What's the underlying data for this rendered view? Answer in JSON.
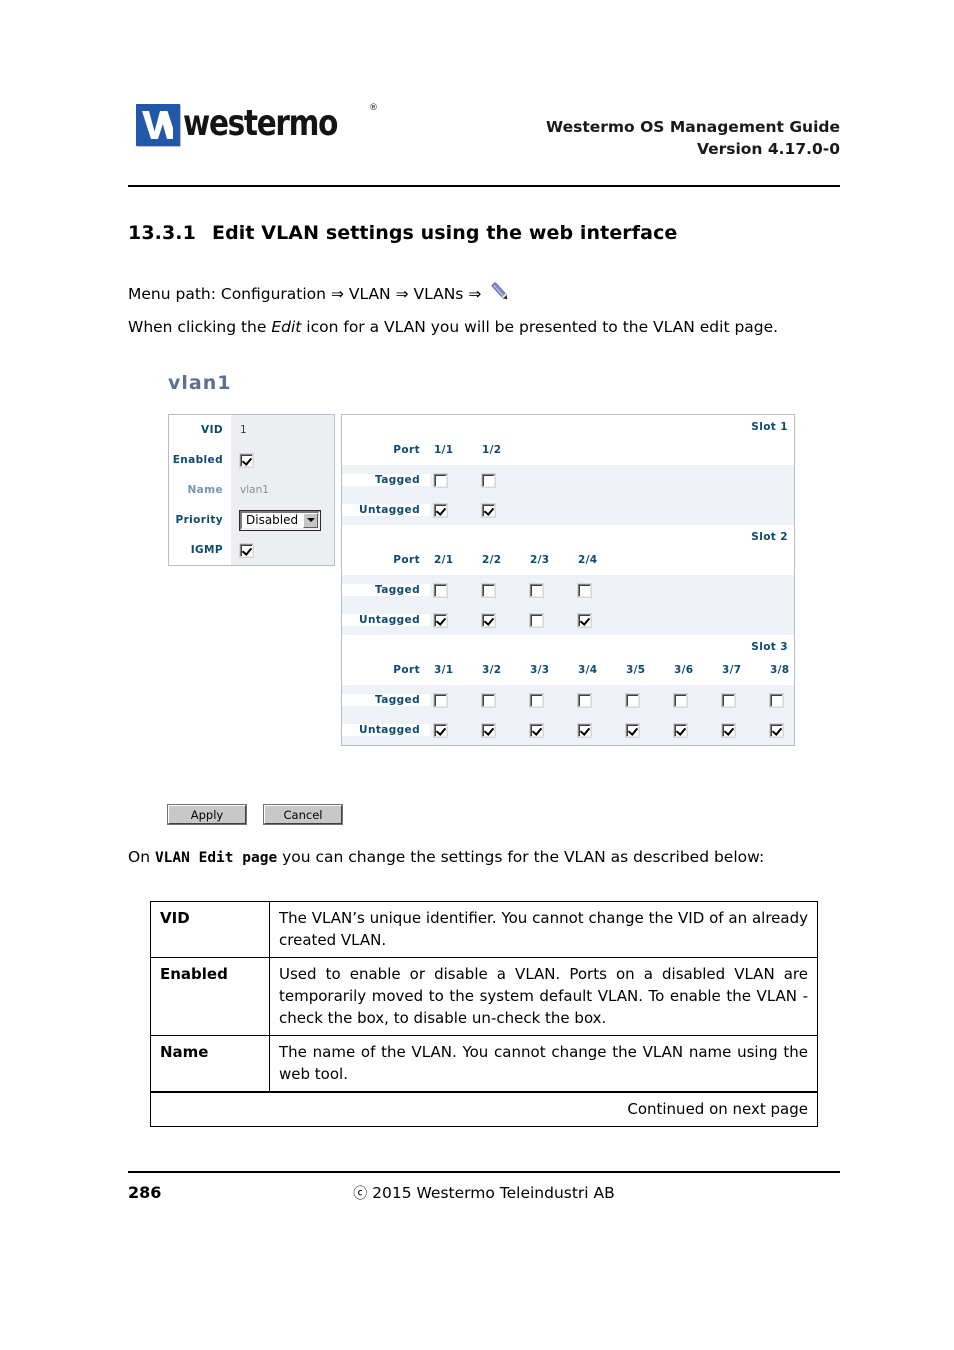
{
  "header": {
    "logo_word": "westermo",
    "logo_registered": "®",
    "title_line1": "Westermo OS Management Guide",
    "title_line2": "Version 4.17.0-0"
  },
  "section": {
    "number": "13.3.1",
    "heading": "Edit VLAN settings using the web interface",
    "menu_path_label": "Menu path: Configuration",
    "menu_path_sep1": "⇒ VLAN",
    "menu_path_sep2": "⇒ VLANs",
    "menu_path_sep3": "⇒",
    "menu_path_icon": "pencil-edit-icon",
    "intro_before": "When clicking the ",
    "intro_italic": "Edit",
    "intro_after": " icon for a VLAN you will be presented to the VLAN edit page."
  },
  "widget": {
    "title": "vlan1",
    "settings": {
      "rows": [
        {
          "label": "VID",
          "type": "text",
          "value": "1",
          "dim": false
        },
        {
          "label": "Enabled",
          "type": "checkbox",
          "checked": true,
          "dim": false
        },
        {
          "label": "Name",
          "type": "text",
          "value": "vlan1",
          "dim": true
        },
        {
          "label": "Priority",
          "type": "select",
          "value": "Disabled",
          "dim": false
        },
        {
          "label": "IGMP",
          "type": "checkbox",
          "checked": true,
          "dim": false
        }
      ]
    },
    "port_row_labels": {
      "port": "Port",
      "tagged": "Tagged",
      "untagged": "Untagged"
    },
    "slots": [
      {
        "title": "Slot 1",
        "ports": [
          "1/1",
          "1/2"
        ],
        "tagged": [
          false,
          false
        ],
        "untagged": [
          true,
          true
        ]
      },
      {
        "title": "Slot 2",
        "ports": [
          "2/1",
          "2/2",
          "2/3",
          "2/4"
        ],
        "tagged": [
          false,
          false,
          false,
          false
        ],
        "untagged": [
          true,
          true,
          false,
          true
        ]
      },
      {
        "title": "Slot 3",
        "ports": [
          "3/1",
          "3/2",
          "3/3",
          "3/4",
          "3/5",
          "3/6",
          "3/7",
          "3/8"
        ],
        "tagged": [
          false,
          false,
          false,
          false,
          false,
          false,
          false,
          false
        ],
        "untagged": [
          true,
          true,
          true,
          true,
          true,
          true,
          true,
          true
        ]
      }
    ],
    "buttons": {
      "apply": "Apply",
      "cancel": "Cancel"
    }
  },
  "body": {
    "para2_before": "On ",
    "para2_mono": "VLAN Edit page",
    "para2_after": " you can change the settings for the VLAN as described below:"
  },
  "desc_table": {
    "rows": [
      {
        "term": "VID",
        "text": "The VLAN’s unique identifier. You cannot change the VID of an already created VLAN."
      },
      {
        "term": "Enabled",
        "text": "Used to enable or disable a VLAN. Ports on a disabled VLAN are temporarily moved to the system default VLAN. To enable the VLAN - check the box, to disable un-check the box."
      },
      {
        "term": "Name",
        "text": "The name of the VLAN. You cannot change the VLAN name using the web tool."
      }
    ],
    "continued": "Continued on next page"
  },
  "footer": {
    "page_number": "286",
    "copyright_mark": "ⓒ",
    "copyright_text": "2015 Westermo Teleindustri AB"
  },
  "colors": {
    "logo_blue": "#2158a8",
    "label_blue": "#0d4a72",
    "title_blue": "#5e6f94",
    "band": "#eef1f6",
    "panel_border": "#b9bdc7"
  }
}
